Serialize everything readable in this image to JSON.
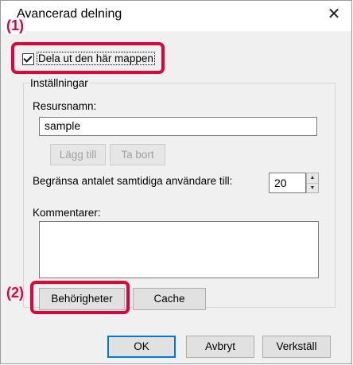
{
  "window": {
    "title": "Avancerad delning",
    "close_glyph": "✕"
  },
  "share_checkbox": {
    "label": "Dela ut den här mappen",
    "checked": true
  },
  "settings": {
    "group_label": "Inställningar",
    "share_name_label": "Resursnamn:",
    "share_name_value": "sample",
    "add_label": "Lägg till",
    "remove_label": "Ta bort",
    "limit_label": "Begränsa antalet samtidiga användare till:",
    "limit_value": "20",
    "comments_label": "Kommentarer:",
    "comments_value": "",
    "permissions_label": "Behörigheter",
    "cache_label": "Cache"
  },
  "footer": {
    "ok_label": "OK",
    "cancel_label": "Avbryt",
    "apply_label": "Verkställ"
  },
  "callouts": {
    "one": "(1)",
    "two": "(2)"
  },
  "colors": {
    "highlight": "#e0003a",
    "focus": "#0078d7"
  }
}
